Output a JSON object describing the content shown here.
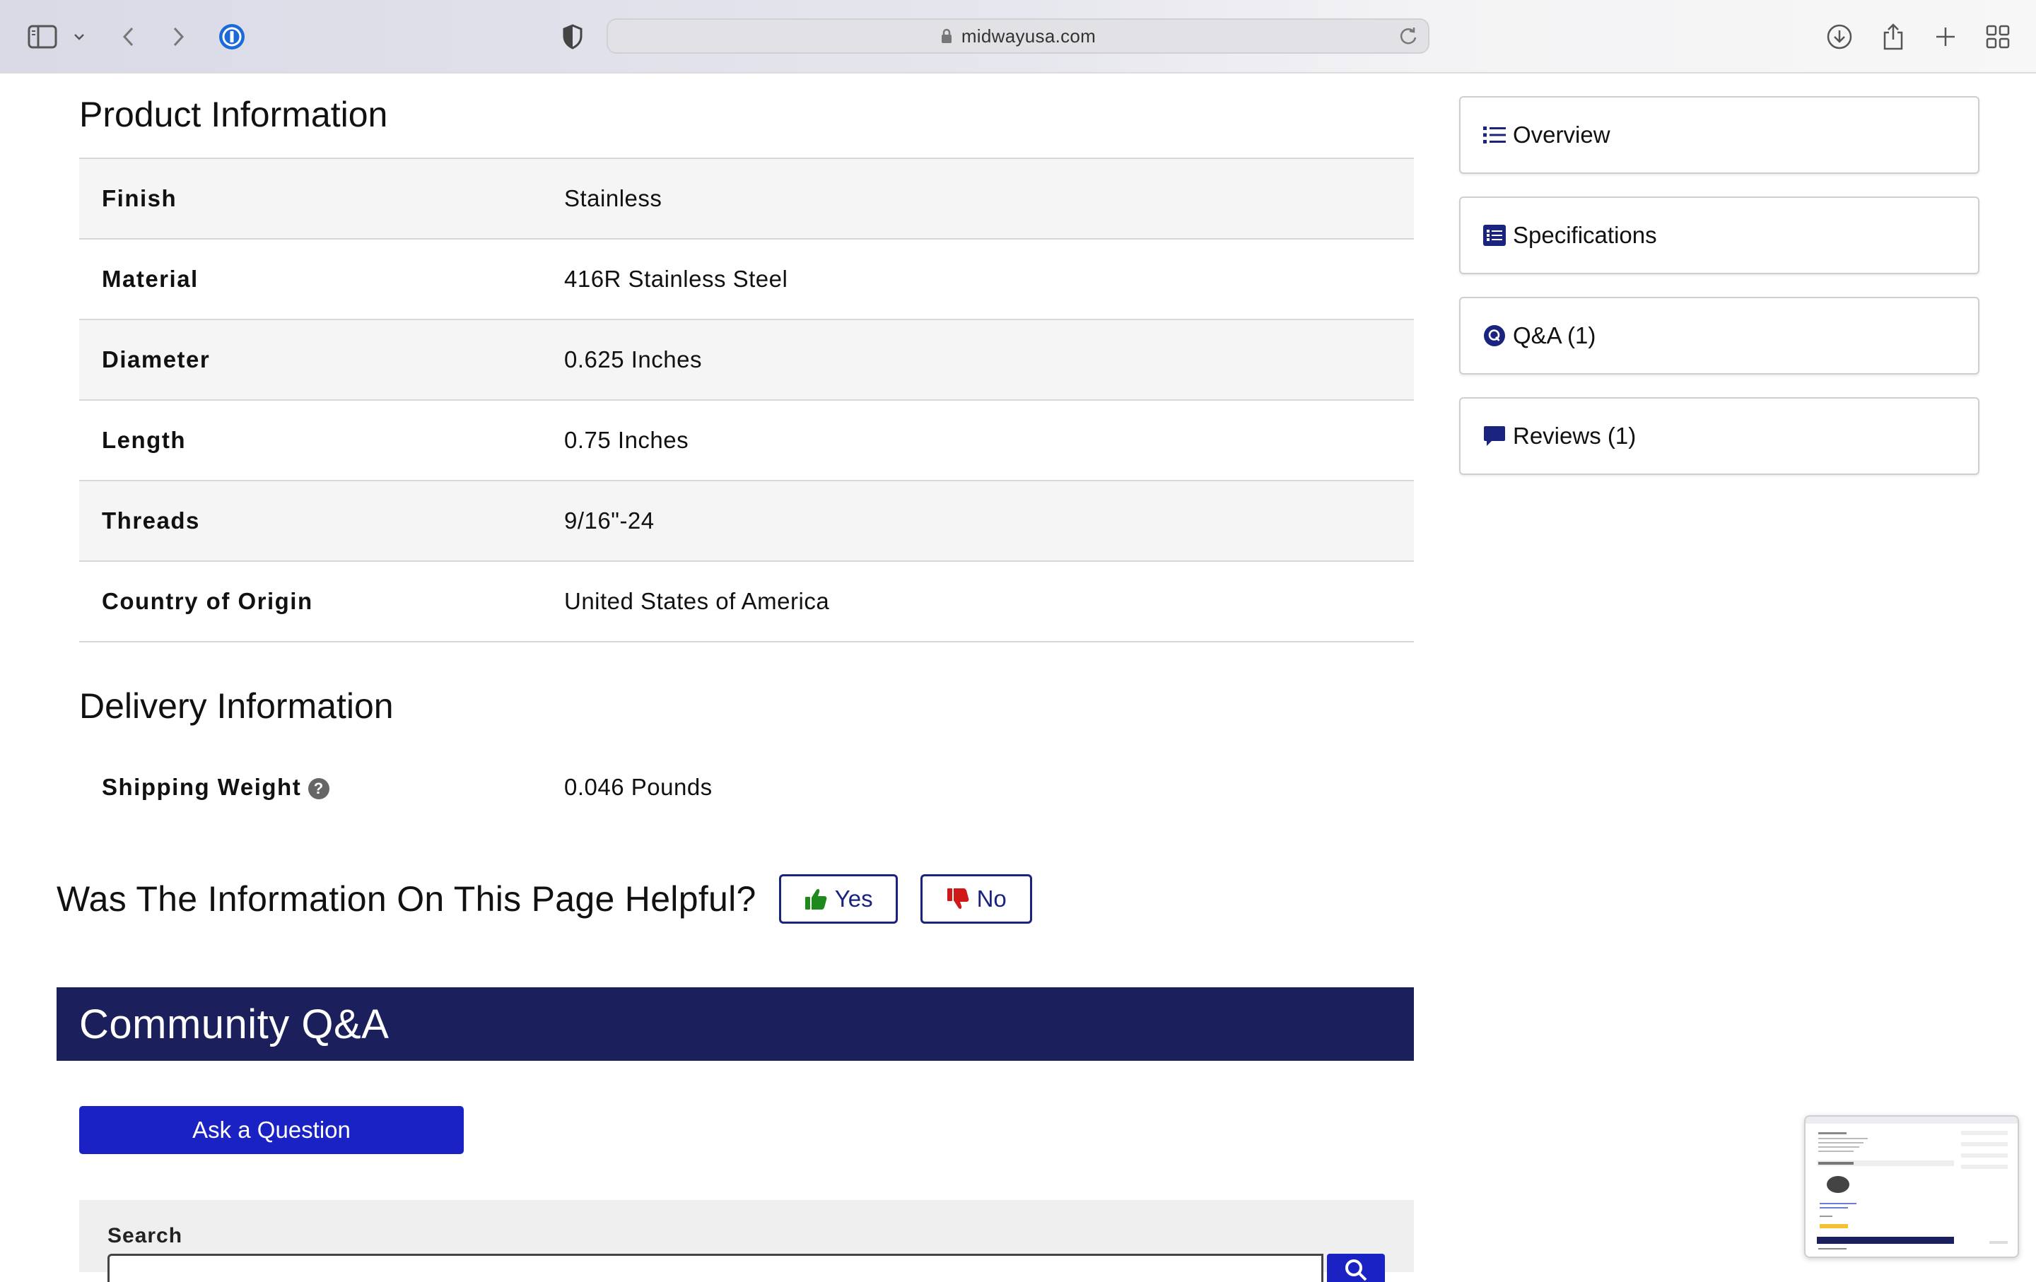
{
  "browser": {
    "url": "midwayusa.com"
  },
  "product_info": {
    "title": "Product Information",
    "rows": [
      {
        "label": "Finish",
        "value": "Stainless"
      },
      {
        "label": "Material",
        "value": "416R Stainless Steel"
      },
      {
        "label": "Diameter",
        "value": "0.625 Inches"
      },
      {
        "label": "Length",
        "value": "0.75 Inches"
      },
      {
        "label": "Threads",
        "value": "9/16\"-24"
      },
      {
        "label": "Country of Origin",
        "value": "United States of America"
      }
    ]
  },
  "delivery_info": {
    "title": "Delivery Information",
    "shipping_label": "Shipping Weight",
    "shipping_help_glyph": "?",
    "shipping_value": "0.046 Pounds"
  },
  "feedback": {
    "question": "Was The Information On This Page Helpful?",
    "yes_label": "Yes",
    "no_label": "No",
    "yes_color": "#1e8a1e",
    "no_color": "#d01818"
  },
  "community_qa": {
    "title": "Community Q&A",
    "ask_button": "Ask a Question",
    "search_label": "Search"
  },
  "side_nav": {
    "items": [
      {
        "label": "Overview",
        "icon": "list-icon"
      },
      {
        "label": "Specifications",
        "icon": "spec-list-icon"
      },
      {
        "label": "Q&A (1)",
        "icon": "qa-icon"
      },
      {
        "label": "Reviews (1)",
        "icon": "comment-icon"
      }
    ]
  },
  "colors": {
    "brand_navy": "#1b1f5c",
    "accent_blue": "#1a22c4",
    "icon_navy": "#1a237e"
  }
}
